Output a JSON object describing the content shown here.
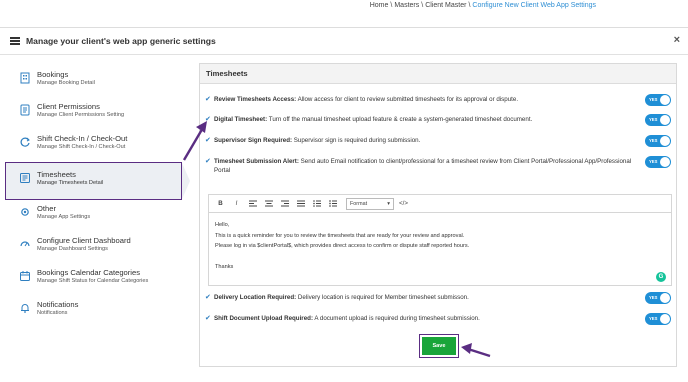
{
  "breadcrumb": {
    "items": [
      "Home",
      "Masters",
      "Client Master"
    ],
    "separator": "\\",
    "current": "Configure New Client Web App Settings"
  },
  "modal": {
    "title": "Manage your client's web app generic settings",
    "close": "×"
  },
  "sidebar": {
    "items": [
      {
        "title": "Bookings",
        "sub": "Manage Booking Detail",
        "icon": "building-icon"
      },
      {
        "title": "Client Permissions",
        "sub": "Manage Client Permissions Setting",
        "icon": "document-icon"
      },
      {
        "title": "Shift Check-In / Check-Out",
        "sub": "Manage Shift Check-In / Check-Out",
        "icon": "refresh-icon"
      },
      {
        "title": "Timesheets",
        "sub": "Manage Timesheets Detail",
        "icon": "timesheet-icon"
      },
      {
        "title": "Other",
        "sub": "Manage App Settings",
        "icon": "gear-icon"
      },
      {
        "title": "Configure Client Dashboard",
        "sub": "Manage Dashboard Settings",
        "icon": "dashboard-icon"
      },
      {
        "title": "Bookings Calendar Categories",
        "sub": "Manage Shift Status for Calendar Categories",
        "icon": "calendar-icon"
      },
      {
        "title": "Notifications",
        "sub": "Notifications",
        "icon": "bell-icon"
      }
    ],
    "active_index": 3
  },
  "panel": {
    "title": "Timesheets",
    "settings": [
      {
        "label": "Review Timesheets Access:",
        "desc": "Allow access for client to review submitted timesheets for its approval or dispute.",
        "toggle": "YES"
      },
      {
        "label": "Digital Timesheet:",
        "desc": "Turn off the manual timesheet upload feature & create a system-generated timesheet document.",
        "toggle": "YES"
      },
      {
        "label": "Supervisor Sign Required:",
        "desc": "Supervisor sign is required during submission.",
        "toggle": "YES"
      },
      {
        "label": "Timesheet Submission Alert:",
        "desc": "Send auto Email notification to client/professional for a timesheet review from Client Portal/Professional App/Professional Portal",
        "toggle": "YES"
      },
      {
        "label": "Delivery Location Required:",
        "desc": "Delivery location is required for Member timesheet submisson.",
        "toggle": "YES"
      },
      {
        "label": "Shift Document Upload Required:",
        "desc": "A document upload is required during timesheet submission.",
        "toggle": "YES"
      }
    ],
    "editor": {
      "toolbar": {
        "bold": "B",
        "italic": "I",
        "format": "Format",
        "source": "</>"
      },
      "lines": [
        "Hello,",
        "This is a quick reminder for you to review the timesheets that are ready for your review and approval.",
        "Please log in via $clientPortal$, which provides direct access to confirm or dispute staff reported hours.",
        "Thanks"
      ],
      "grammarly": "G"
    },
    "save_label": "Save"
  },
  "colors": {
    "accent": "#1f8fd6",
    "highlight": "#5a2d82",
    "save": "#19a53a",
    "link": "#2f8fd4"
  }
}
